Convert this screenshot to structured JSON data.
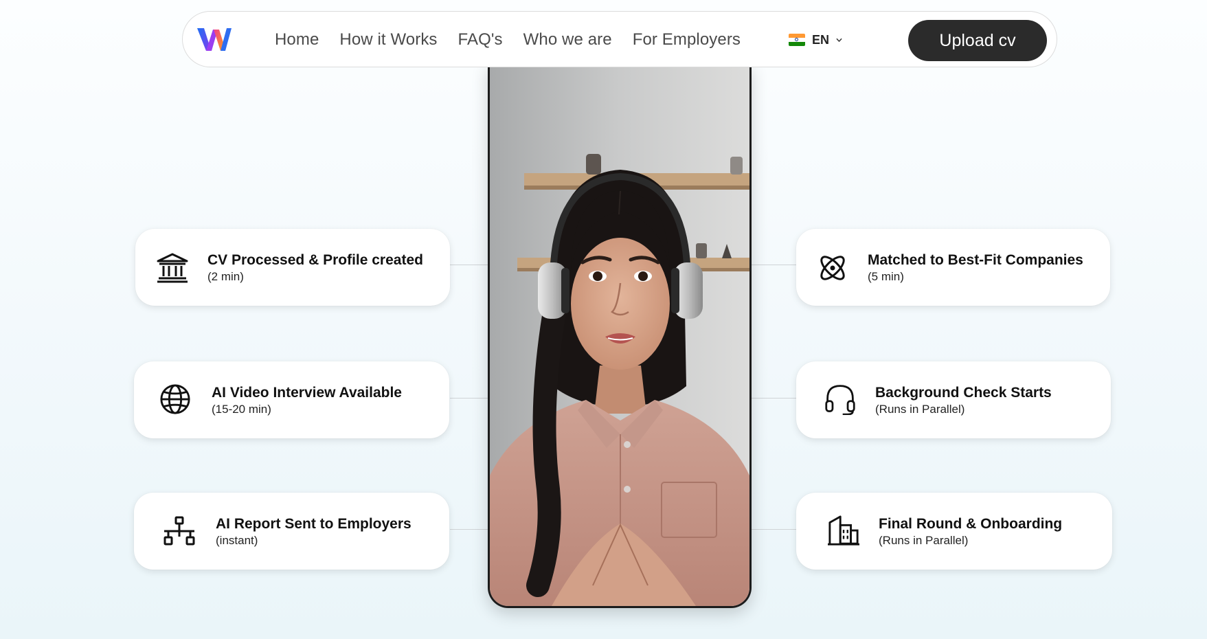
{
  "brand": {
    "logo_icon": "w-logo-icon",
    "colors": [
      "#2b6ff0",
      "#8a3df2",
      "#f0446e",
      "#ffb020"
    ]
  },
  "nav": {
    "links": [
      "Home",
      "How it Works",
      "FAQ's",
      "Who we are",
      "For Employers"
    ],
    "language": {
      "code": "EN",
      "flag_icon": "india-flag-icon"
    },
    "cta": "Upload cv"
  },
  "steps_left": [
    {
      "icon": "bank-icon",
      "title": "CV Processed & Profile created",
      "sub": "(2 min)"
    },
    {
      "icon": "globe-icon",
      "title": "AI Video Interview Available",
      "sub": "(15-20 min)"
    },
    {
      "icon": "network-icon",
      "title": "AI Report Sent to Employers",
      "sub": "(instant)"
    }
  ],
  "steps_right": [
    {
      "icon": "atom-icon",
      "title": "Matched to Best-Fit Companies",
      "sub": "(5 min)"
    },
    {
      "icon": "headphones-icon",
      "title": "Background Check Starts",
      "sub": "(Runs in Parallel)"
    },
    {
      "icon": "building-icon",
      "title": "Final Round & Onboarding",
      "sub": "(Runs in Parallel)"
    }
  ],
  "video": {
    "subject": "interview-video"
  }
}
